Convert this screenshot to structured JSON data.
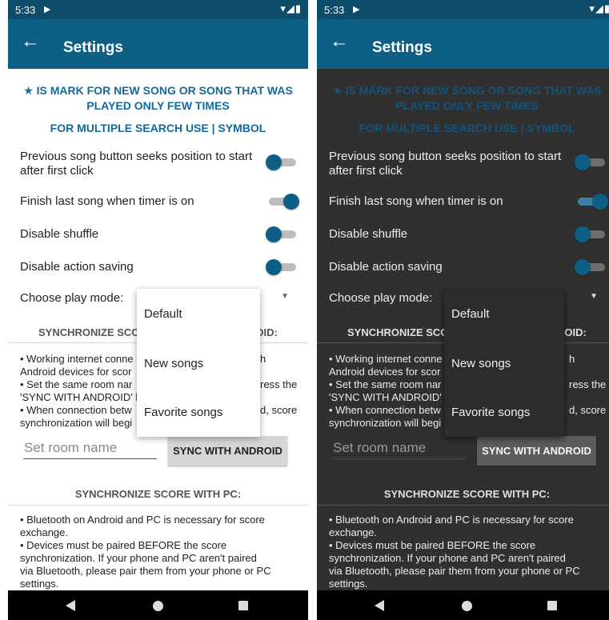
{
  "status": {
    "time": "5:33",
    "play": "▶",
    "icons": "▾◢▮"
  },
  "appbar": {
    "back": "←",
    "title": "Settings"
  },
  "notice": {
    "line1": "★ IS MARK FOR NEW SONG OR SONG THAT WAS",
    "line2": "PLAYED ONLY FEW TIMES",
    "line3": "FOR MULTIPLE SEARCH USE | SYMBOL"
  },
  "prefs": {
    "prev_seek": {
      "line1": "Previous song button seeks position to start",
      "line2": "after first click"
    },
    "finish_last": "Finish last song when timer is on",
    "disable_shuffle": "Disable shuffle",
    "disable_action_saving": "Disable action saving",
    "play_mode_label": "Choose play mode:"
  },
  "play_mode_options": [
    "Default",
    "New songs",
    "Favorite songs"
  ],
  "switch_state": {
    "light": {
      "prev_seek": false,
      "finish_last": true,
      "disable_shuffle": false,
      "disable_action_saving": false
    },
    "dark": {
      "prev_seek": false,
      "finish_last": true,
      "disable_shuffle": false,
      "disable_action_saving": false
    }
  },
  "sync_android": {
    "title_left": "SYNCHRONIZE SCO",
    "title_right": "ROID:",
    "info_lines": [
      {
        "left": "• Working internet conne",
        "right": "h"
      },
      {
        "left": "Android devices for scor",
        "right": ""
      },
      {
        "left": "• Set the same room nar",
        "right": "ress the"
      },
      {
        "left": "'SYNC WITH ANDROID' b",
        "right": ""
      },
      {
        "left": "• When connection betw",
        "right": "d, score"
      },
      {
        "left": "synchronization will begi",
        "right": ""
      }
    ],
    "room_placeholder": "Set room name",
    "sync_button": "SYNC WITH ANDROID"
  },
  "sync_pc": {
    "title": "SYNCHRONIZE SCORE WITH PC:",
    "info_lines": [
      "• Bluetooth on Android and PC is necessary for score",
      "exchange.",
      "• Devices must be paired BEFORE the score",
      "synchronization. If your phone and PC aren't paired",
      "via Bluetooth, please pair them from your phone or PC",
      "settings."
    ]
  },
  "colors": {
    "status_bar": "#0e4c6c",
    "app_bar": "#0e5f86",
    "accent": "#0e5f86",
    "notice_text": "#13699a",
    "dark_background": "#303030"
  }
}
